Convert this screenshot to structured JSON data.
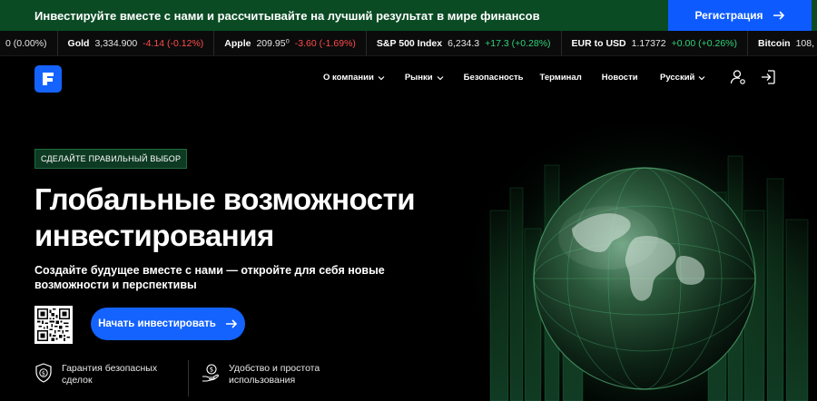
{
  "promo": {
    "text": "Инвестируйте вместе с нами и рассчитывайте на лучший результат в мире финансов",
    "button_label": "Регистрация"
  },
  "ticker": [
    {
      "name": "",
      "price": "0 (0.00%)",
      "change": "",
      "trend": "neutral"
    },
    {
      "name": "Gold",
      "price": "3,334.900",
      "change": "-4.14 (-0.12%)",
      "trend": "neg"
    },
    {
      "name": "Apple",
      "price": "209.95⁰",
      "change": "-3.60 (-1.69%)",
      "trend": "neg"
    },
    {
      "name": "S&P 500 Index",
      "price": "6,234.3",
      "change": "+17.3 (+0.28%)",
      "trend": "pos"
    },
    {
      "name": "EUR to USD",
      "price": "1.17372",
      "change": "+0.00 (+0.26%)",
      "trend": "pos"
    },
    {
      "name": "Bitcoin",
      "price": "108,",
      "change": "",
      "trend": "neutral"
    }
  ],
  "nav": {
    "items": [
      {
        "label": "О компании",
        "dropdown": true
      },
      {
        "label": "Рынки",
        "dropdown": true
      },
      {
        "label": "Безопасность",
        "dropdown": false
      },
      {
        "label": "Терминал",
        "dropdown": false
      },
      {
        "label": "Новости",
        "dropdown": false
      }
    ],
    "language": "Русский"
  },
  "hero": {
    "badge": "СДЕЛАЙТЕ ПРАВИЛЬНЫЙ ВЫБОР",
    "title_line1": "Глобальные возможности",
    "title_line2": "инвестирования",
    "subtitle": "Создайте будущее вместе с нами — откройте для себя новые возможности и перспективы",
    "cta_label": "Начать инвестировать"
  },
  "features": [
    {
      "icon": "shield-dollar-icon",
      "line1": "Гарантия безопасных",
      "line2": "сделок"
    },
    {
      "icon": "dollar-hand-icon",
      "line1": "Удобство и простота",
      "line2": "использования"
    }
  ],
  "colors": {
    "accent": "#1463ff",
    "promo_bg": "#0a4b24",
    "badge_bg": "#0d3a22",
    "negative": "#ff4b4b",
    "positive": "#2fd27a"
  }
}
